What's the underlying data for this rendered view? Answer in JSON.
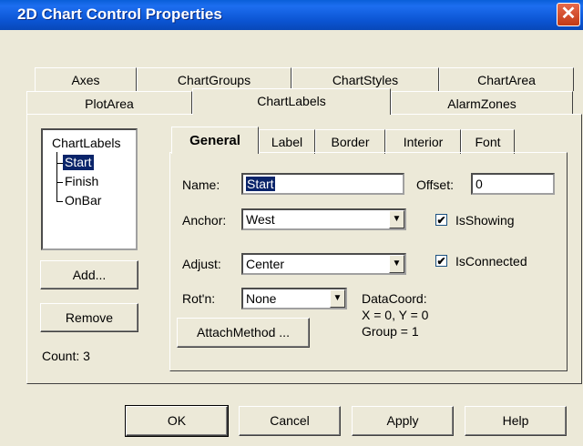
{
  "window": {
    "title": "2D Chart Control Properties",
    "close_glyph": "✕"
  },
  "tabs_row1": [
    "Axes",
    "ChartGroups",
    "ChartStyles",
    "ChartArea"
  ],
  "tabs_row2": [
    "PlotArea",
    "ChartLabels",
    "AlarmZones"
  ],
  "tree": {
    "root": "ChartLabels",
    "items": [
      "Start",
      "Finish",
      "OnBar"
    ],
    "selected": "Start"
  },
  "buttons_left": {
    "add": "Add...",
    "remove": "Remove"
  },
  "count_text": "Count: 3",
  "subtabs": [
    "General",
    "Label",
    "Border",
    "Interior",
    "Font"
  ],
  "general": {
    "name_label": "Name:",
    "name_value": "Start",
    "offset_label": "Offset:",
    "offset_value": "0",
    "anchor_label": "Anchor:",
    "anchor_value": "West",
    "adjust_label": "Adjust:",
    "adjust_value": "Center",
    "rotn_label": "Rot'n:",
    "rotn_value": "None",
    "isshowing_label": "IsShowing",
    "isshowing_checked": true,
    "isconnected_label": "IsConnected",
    "isconnected_checked": true,
    "datacoord_title": "DataCoord:",
    "datacoord_xy": "X = 0, Y = 0",
    "datacoord_group": "Group = 1",
    "attach_button": "AttachMethod ..."
  },
  "footer": {
    "ok": "OK",
    "cancel": "Cancel",
    "apply": "Apply",
    "help": "Help"
  },
  "check_glyph": "✔",
  "dropdown_glyph": "▼"
}
